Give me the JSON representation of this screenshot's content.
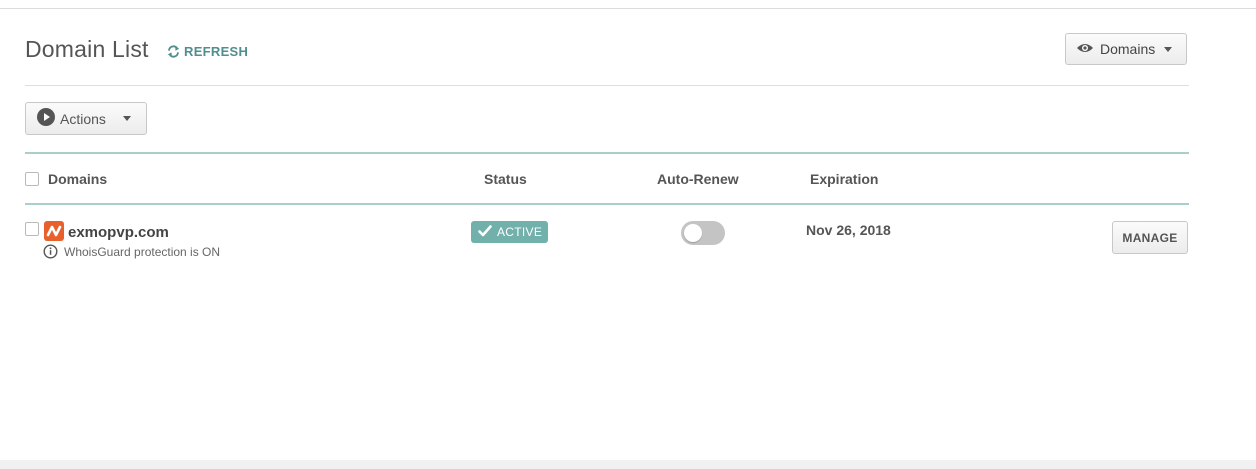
{
  "header": {
    "title": "Domain List",
    "refresh_label": "REFRESH",
    "view_select_label": "Domains"
  },
  "toolbar": {
    "actions_label": "Actions"
  },
  "table": {
    "columns": {
      "domains": "Domains",
      "status": "Status",
      "auto_renew": "Auto-Renew",
      "expiration": "Expiration"
    },
    "rows": [
      {
        "domain": "exmopvp.com",
        "whoisguard_note": "WhoisGuard protection is ON",
        "status": "ACTIVE",
        "auto_renew_on": false,
        "expiration": "Nov 26, 2018",
        "manage_label": "MANAGE"
      }
    ]
  },
  "colors": {
    "accent_teal": "#4f8f8d",
    "status_active": "#72b0ab",
    "table_rule": "#a9cfcc",
    "brand_orange": "#e8602b"
  },
  "icons": {
    "refresh": "refresh-icon",
    "eye": "eye-icon",
    "play": "play-icon",
    "check": "check-icon",
    "info": "info-icon",
    "brand": "brand-logo-icon"
  }
}
